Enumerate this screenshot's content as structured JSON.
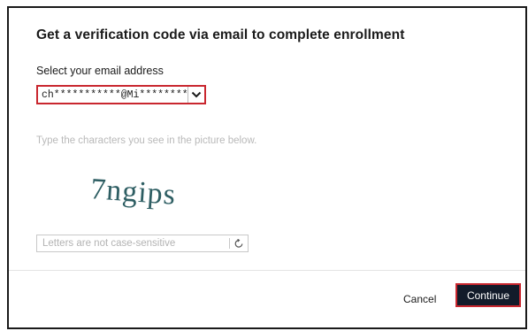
{
  "dialog": {
    "title": "Get a verification code via email to complete enrollment",
    "email_label": "Select your email address",
    "email_selected": "ch***********@Mi********",
    "captcha_hint": "Type the characters you see in the picture below.",
    "captcha_text": "7ngips",
    "captcha_placeholder": "Letters are not case-sensitive",
    "cancel_label": "Cancel",
    "continue_label": "Continue"
  },
  "colors": {
    "highlight": "#c9272f",
    "primary_button": "#121b2a",
    "captcha_ink": "#2e5e63",
    "hint_text": "#b9b9b9"
  },
  "icons": {
    "email_dropdown": "chevron-down-icon",
    "captcha_refresh": "refresh-icon"
  }
}
